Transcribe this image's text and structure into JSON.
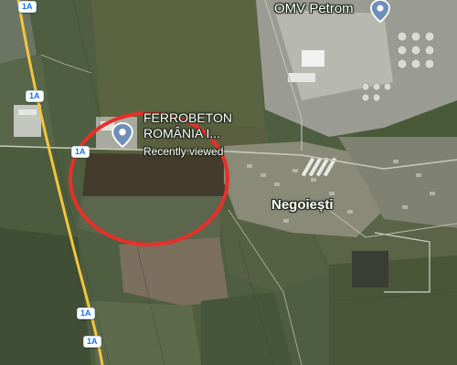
{
  "map": {
    "places": {
      "omv": {
        "name": "OMV Petrom",
        "icon": "map-pin-icon"
      },
      "ferrobeton": {
        "name": "FERROBETON ROMÂNIA I...",
        "subtitle": "Recently viewed",
        "icon": "map-pin-icon"
      },
      "town": {
        "name": "Negoiești"
      }
    },
    "road_shields": [
      "1A",
      "1A",
      "1A",
      "1A",
      "1A"
    ],
    "colors": {
      "highlight_circle": "#e8302a",
      "road_yellow": "#f2c53d",
      "shield_text": "#1a73e8",
      "pin": "#6f8fb8"
    }
  }
}
